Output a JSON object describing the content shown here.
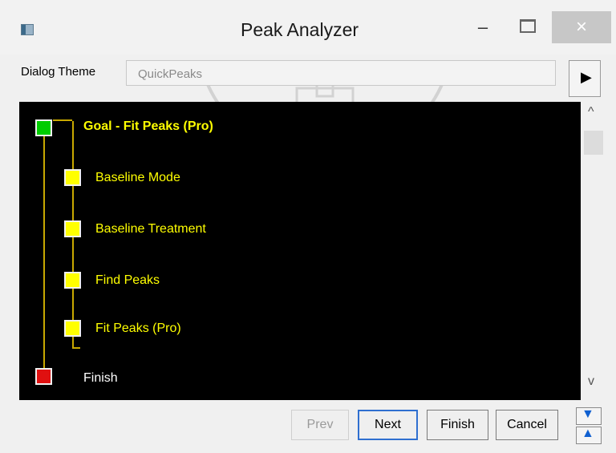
{
  "window": {
    "title": "Peak Analyzer",
    "controls": {
      "minimize": "–",
      "maximize": "□",
      "close": "×"
    }
  },
  "theme": {
    "label": "Dialog Theme",
    "value": "QuickPeaks",
    "arrow": "▶"
  },
  "tree": {
    "goal": "Goal - Fit Peaks (Pro)",
    "items": [
      "Baseline Mode",
      "Baseline Treatment",
      "Find Peaks",
      "Fit Peaks (Pro)"
    ],
    "finish": "Finish"
  },
  "buttons": {
    "prev": "Prev",
    "next": "Next",
    "finish": "Finish",
    "cancel": "Cancel"
  },
  "colors": {
    "tree_background": "#000000",
    "goal_node": "#00cc00",
    "step_node": "#ffff00",
    "finish_node": "#e01010",
    "text_yellow": "#ffff00"
  }
}
